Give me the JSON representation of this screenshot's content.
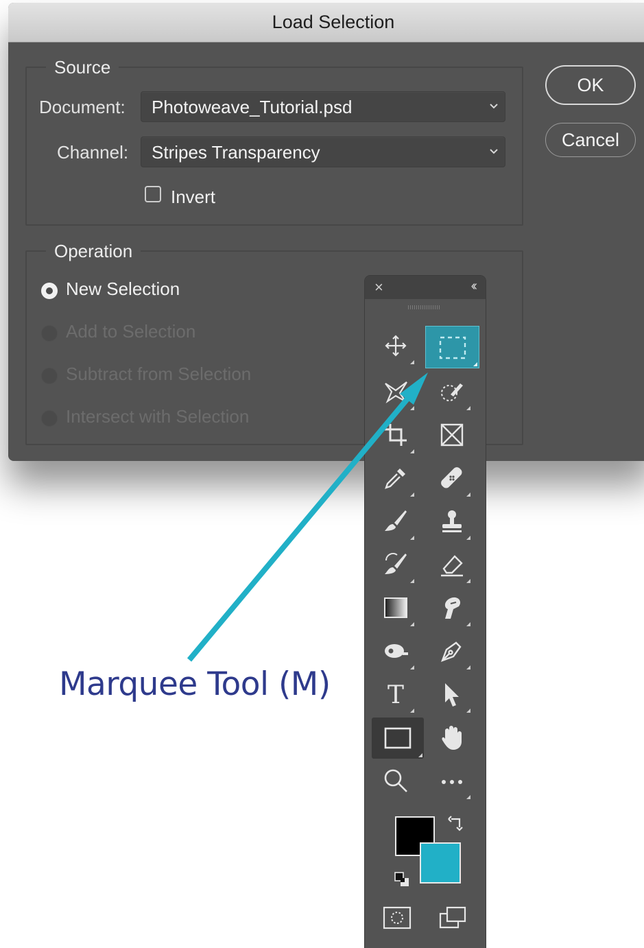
{
  "dialog": {
    "title": "Load Selection",
    "source": {
      "title": "Source",
      "document_label": "Document:",
      "document_value": "Photoweave_Tutorial.psd",
      "channel_label": "Channel:",
      "channel_value": "Stripes Transparency",
      "invert_label": "Invert",
      "invert_checked": false
    },
    "operation": {
      "title": "Operation",
      "options": [
        {
          "label": "New Selection",
          "selected": true,
          "enabled": true
        },
        {
          "label": "Add to Selection",
          "selected": false,
          "enabled": false
        },
        {
          "label": "Subtract from Selection",
          "selected": false,
          "enabled": false
        },
        {
          "label": "Intersect with Selection",
          "selected": false,
          "enabled": false
        }
      ]
    },
    "buttons": {
      "ok": "OK",
      "cancel": "Cancel"
    }
  },
  "toolbar": {
    "close_glyph": "×",
    "collapse_glyph": "‹‹",
    "tools": [
      [
        "move-tool-icon",
        "rectangular-marquee-tool-icon"
      ],
      [
        "lasso-tool-icon",
        "quick-selection-tool-icon"
      ],
      [
        "crop-tool-icon",
        "frame-tool-icon"
      ],
      [
        "eyedropper-tool-icon",
        "healing-brush-tool-icon"
      ],
      [
        "brush-tool-icon",
        "clone-stamp-tool-icon"
      ],
      [
        "history-brush-tool-icon",
        "eraser-tool-icon"
      ],
      [
        "gradient-tool-icon",
        "smudge-tool-icon"
      ],
      [
        "dodge-tool-icon",
        "pen-tool-icon"
      ],
      [
        "type-tool-icon",
        "path-selection-tool-icon"
      ],
      [
        "rectangle-tool-icon",
        "hand-tool-icon"
      ],
      [
        "zoom-tool-icon",
        "more-tools-icon"
      ]
    ],
    "selected_tool": "rectangular-marquee-tool-icon",
    "foreground_color": "#000000",
    "background_color": "#21b0c7",
    "quick_mask_icon": "quick-mask-icon",
    "screen_mode_icon": "screen-mode-icon"
  },
  "annotation": {
    "caption": "Marquee Tool (M)",
    "arrow_color": "#21b0c7"
  }
}
